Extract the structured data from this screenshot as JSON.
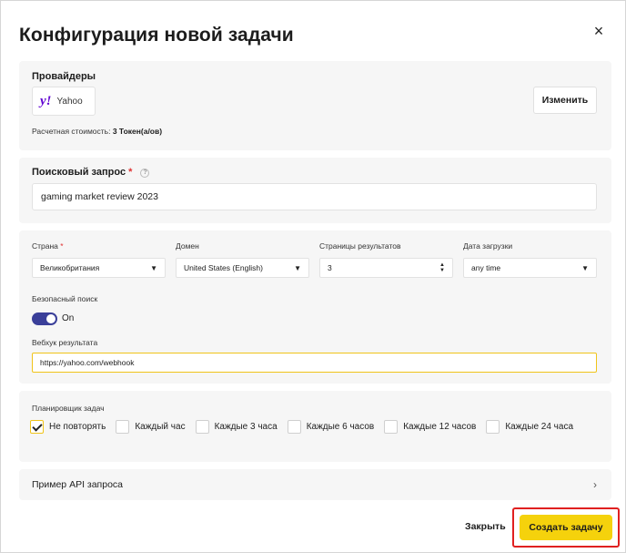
{
  "dialog": {
    "title": "Конфигурация новой задачи",
    "close_icon": "×"
  },
  "providers": {
    "label": "Провайдеры",
    "items": [
      {
        "logo": "y!",
        "name": "Yahoo"
      }
    ],
    "change_button": "Изменить",
    "cost_label": "Расчетная стоимость:",
    "cost_value": "3 Токен(а/ов)"
  },
  "search": {
    "label": "Поисковый запрос",
    "required_mark": "*",
    "help_icon": "?",
    "value": "gaming market review 2023"
  },
  "settings": {
    "country": {
      "label": "Страна",
      "required_mark": "*",
      "value": "Великобритания"
    },
    "domain": {
      "label": "Домен",
      "value": "United States (English)"
    },
    "pages": {
      "label": "Страницы результатов",
      "value": "3"
    },
    "date": {
      "label": "Дата загрузки",
      "value": "any time"
    },
    "safe_search": {
      "label": "Безопасный поиск",
      "state": "On",
      "enabled": true
    },
    "webhook": {
      "label": "Вебхук результата",
      "value": "https://yahoo.com/webhook"
    }
  },
  "scheduler": {
    "label": "Планировщик задач",
    "options": [
      {
        "label": "Не повторять",
        "checked": true
      },
      {
        "label": "Каждый час",
        "checked": false
      },
      {
        "label": "Каждые 3 часа",
        "checked": false
      },
      {
        "label": "Каждые 6 часов",
        "checked": false
      },
      {
        "label": "Каждые 12 часов",
        "checked": false
      },
      {
        "label": "Каждые 24 часа",
        "checked": false
      }
    ]
  },
  "api_example": {
    "label": "Пример API запроса",
    "chevron_icon": "›"
  },
  "footer": {
    "close_label": "Закрыть",
    "create_label": "Создать задачу"
  },
  "colors": {
    "accent": "#f5d20c",
    "toggle": "#3a3f99",
    "highlight": "#e02020"
  }
}
